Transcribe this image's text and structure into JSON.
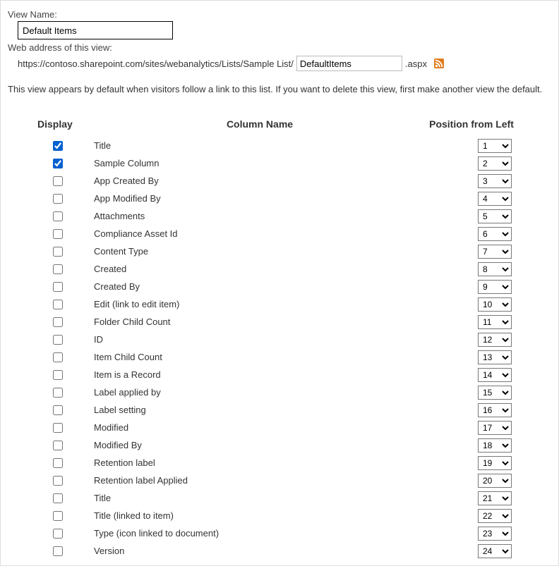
{
  "labels": {
    "view_name": "View Name:",
    "web_address": "Web address of this view:"
  },
  "view_name_value": "Default Items",
  "url_prefix": "https://contoso.sharepoint.com/sites/webanalytics/Lists/Sample List/",
  "url_value": "DefaultItems",
  "url_suffix": ".aspx",
  "note": "This view appears by default when visitors follow a link to this list. If you want to delete this view, first make another view the default.",
  "headers": {
    "display": "Display",
    "column": "Column Name",
    "position": "Position from Left"
  },
  "columns": [
    {
      "name": "Title",
      "display": true,
      "pos": 1
    },
    {
      "name": "Sample Column",
      "display": true,
      "pos": 2
    },
    {
      "name": "App Created By",
      "display": false,
      "pos": 3
    },
    {
      "name": "App Modified By",
      "display": false,
      "pos": 4
    },
    {
      "name": "Attachments",
      "display": false,
      "pos": 5
    },
    {
      "name": "Compliance Asset Id",
      "display": false,
      "pos": 6
    },
    {
      "name": "Content Type",
      "display": false,
      "pos": 7
    },
    {
      "name": "Created",
      "display": false,
      "pos": 8
    },
    {
      "name": "Created By",
      "display": false,
      "pos": 9
    },
    {
      "name": "Edit (link to edit item)",
      "display": false,
      "pos": 10
    },
    {
      "name": "Folder Child Count",
      "display": false,
      "pos": 11
    },
    {
      "name": "ID",
      "display": false,
      "pos": 12
    },
    {
      "name": "Item Child Count",
      "display": false,
      "pos": 13
    },
    {
      "name": "Item is a Record",
      "display": false,
      "pos": 14
    },
    {
      "name": "Label applied by",
      "display": false,
      "pos": 15
    },
    {
      "name": "Label setting",
      "display": false,
      "pos": 16
    },
    {
      "name": "Modified",
      "display": false,
      "pos": 17
    },
    {
      "name": "Modified By",
      "display": false,
      "pos": 18
    },
    {
      "name": "Retention label",
      "display": false,
      "pos": 19
    },
    {
      "name": "Retention label Applied",
      "display": false,
      "pos": 20
    },
    {
      "name": "Title",
      "display": false,
      "pos": 21
    },
    {
      "name": "Title (linked to item)",
      "display": false,
      "pos": 22
    },
    {
      "name": "Type (icon linked to document)",
      "display": false,
      "pos": 23
    },
    {
      "name": "Version",
      "display": false,
      "pos": 24
    }
  ]
}
